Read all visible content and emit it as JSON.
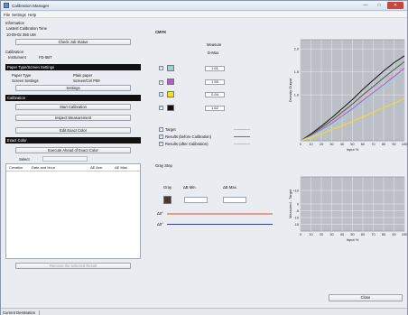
{
  "window": {
    "title": "Calibration Manager",
    "minimize": "—",
    "maximize": "□",
    "close": "✕"
  },
  "menu": [
    "File",
    "Settings",
    "Help"
  ],
  "left": {
    "information": "Information",
    "latest_label": "Lastest Calibration Time",
    "latest_value": "10-09-02 356 UM",
    "check_button": "Check Job Status",
    "calibration": "Calibration",
    "instrument_label": "Instrument",
    "instrument_value": "FD-5BT",
    "paper_header": "Paper Type/Screen Settings",
    "paper_type_label": "Paper Type",
    "paper_type_value": "Plain paper",
    "screen_label": "Screen Settings",
    "screen_value": "Screen/Ctrl P89",
    "settings_button": "Settings",
    "calibration_header": "Calibration",
    "start_button": "Start Calibration",
    "inspect_button": "Inspect Measurement",
    "edit_button": "Edit Exact Color",
    "exact_header": "Exact Color",
    "execute_button": "Execute Ahead of Exact Color",
    "select_label": "Select",
    "table_headers": [
      "Creation",
      "Date and Hour",
      "ΔE Ave.",
      "ΔE Max."
    ],
    "remove_button": "Remove the selected Result"
  },
  "middle": {
    "cmyk_title": "CMYK",
    "measure_label": "Measure",
    "dmax_label": "D-Max",
    "inks": [
      {
        "color": "#8fd6dc",
        "value": "1.61"
      },
      {
        "color": "#b45bc5",
        "value": "1.55"
      },
      {
        "color": "#f2e21d",
        "value": "0.94"
      },
      {
        "color": "#111111",
        "value": "1.62"
      }
    ],
    "legend": [
      {
        "label": "Target",
        "color": "#c9b7d6"
      },
      {
        "label": "Results (before Calibration)",
        "color": "#8a5db0"
      },
      {
        "label": "Results (after Calibration)",
        "color": "#c9b7d6"
      }
    ],
    "gray_title": "Gray Step",
    "gray_label": "Gray",
    "ab_min_label": "ΔB Min.",
    "ab_max_label": "ΔB Max.",
    "lo_label": "Δ0°",
    "hi_label": "Δ0°",
    "line_colors": [
      "#e89b8b",
      "#3b3f9a"
    ]
  },
  "close_button": "Close",
  "status": "Current Destination",
  "chart_data": [
    {
      "type": "line",
      "xlabel": "Input %",
      "ylabel": "Density Output",
      "xlim": [
        0,
        100
      ],
      "ylim": [
        0,
        2.2
      ],
      "x_ticks": [
        "0",
        "10",
        "20",
        "30",
        "40",
        "50",
        "60",
        "70",
        "80",
        "90",
        "100"
      ],
      "y_ticks": [
        "1.0",
        "1.5",
        "2.0"
      ],
      "grid": true,
      "series": [
        {
          "color": "#111111",
          "x": [
            0,
            10,
            20,
            30,
            40,
            50,
            60,
            70,
            80,
            90,
            100
          ],
          "values": [
            0,
            0.15,
            0.32,
            0.5,
            0.7,
            0.9,
            1.12,
            1.32,
            1.52,
            1.7,
            1.85
          ]
        },
        {
          "color": "#555555",
          "x": [
            0,
            10,
            20,
            30,
            40,
            50,
            60,
            70,
            80,
            90,
            100
          ],
          "values": [
            0,
            0.13,
            0.28,
            0.44,
            0.62,
            0.8,
            1.0,
            1.18,
            1.37,
            1.55,
            1.72
          ]
        },
        {
          "color": "#b45bc5",
          "x": [
            0,
            10,
            20,
            30,
            40,
            50,
            60,
            70,
            80,
            90,
            100
          ],
          "values": [
            0,
            0.11,
            0.24,
            0.38,
            0.54,
            0.7,
            0.88,
            1.05,
            1.22,
            1.4,
            1.58
          ]
        },
        {
          "color": "#8fd6dc",
          "x": [
            0,
            10,
            20,
            30,
            40,
            50,
            60,
            70,
            80,
            90,
            100
          ],
          "values": [
            0,
            0.1,
            0.22,
            0.35,
            0.5,
            0.66,
            0.83,
            1.0,
            1.17,
            1.34,
            1.52
          ]
        },
        {
          "color": "#f2e21d",
          "x": [
            0,
            10,
            20,
            30,
            40,
            50,
            60,
            70,
            80,
            90,
            100
          ],
          "values": [
            0,
            0.07,
            0.15,
            0.24,
            0.33,
            0.42,
            0.52,
            0.62,
            0.72,
            0.82,
            0.92
          ]
        }
      ]
    },
    {
      "type": "line",
      "xlabel": "Input %",
      "ylabel": "Measured - Target",
      "xlim": [
        0,
        100
      ],
      "ylim": [
        -20,
        20
      ],
      "x_ticks": [
        "0",
        "10",
        "20",
        "30",
        "40",
        "50",
        "60",
        "70",
        "80",
        "90",
        "100"
      ],
      "y_ticks": [
        "+10",
        "0",
        "-5",
        "-10",
        "-15"
      ],
      "grid": true,
      "series": []
    }
  ]
}
